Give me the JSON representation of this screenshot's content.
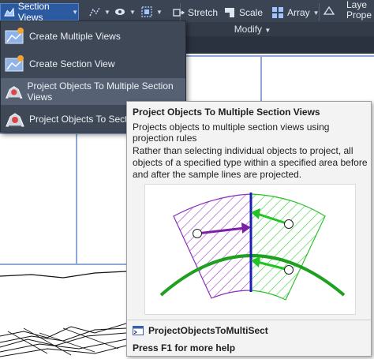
{
  "ribbon": {
    "section_views_label": "Section Views",
    "stretch_label": "Stretch",
    "scale_label": "Scale",
    "array_label": "Array",
    "layer_label": "Laye",
    "properties_label": "Prope",
    "modify_panel_label": "Modify"
  },
  "menu": {
    "items": [
      {
        "label": "Create Multiple Views"
      },
      {
        "label": "Create Section View"
      },
      {
        "label": "Project Objects To Multiple Section Views"
      },
      {
        "label": "Project Objects To Section Vi"
      }
    ]
  },
  "tooltip": {
    "title": "Project Objects To Multiple Section Views",
    "description": "Projects objects to multiple section views using projection rules",
    "body": "Rather than selecting individual objects to project, all objects of a specified type within a specified area before and after the sample lines are projected.",
    "command": "ProjectObjectsToMultiSect",
    "help": "Press F1 for more help"
  },
  "colors": {
    "ribbon_bg": "#3b4453",
    "menu_bg": "#3f4857",
    "menu_highlight": "#566273",
    "tooltip_bg": "#f3f3f3"
  }
}
